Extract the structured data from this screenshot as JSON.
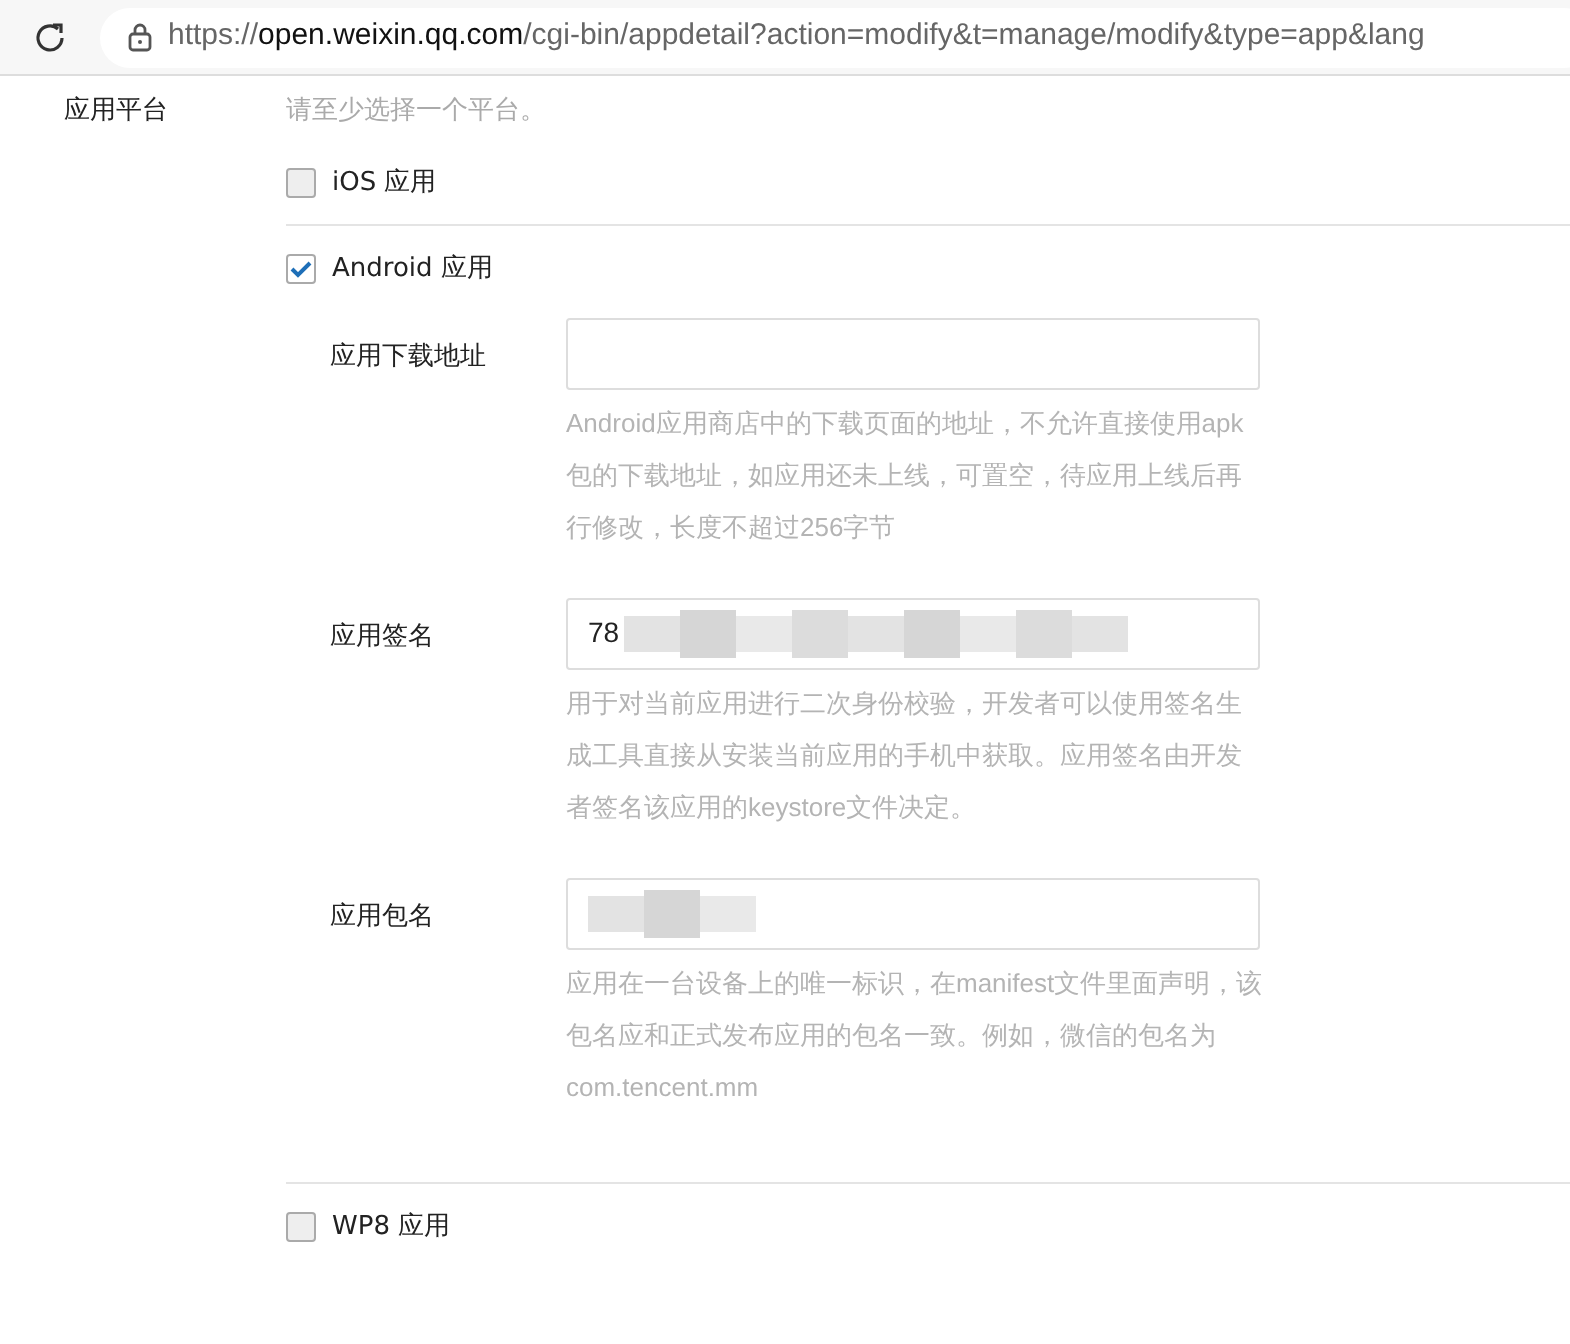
{
  "address_bar": {
    "url_parts": [
      {
        "text": "https://",
        "emphasis": false
      },
      {
        "text": "open.weixin.qq.com",
        "emphasis": true
      },
      {
        "text": "/cgi-bin/appdetail?action=modify&t=manage/modify&type=app&lang",
        "emphasis": false
      }
    ]
  },
  "form": {
    "label": "应用平台",
    "hint": "请至少选择一个平台。",
    "platforms": [
      {
        "label": "iOS 应用",
        "checked": false
      },
      {
        "label": "Android 应用",
        "checked": true,
        "fields": [
          {
            "label": "应用下载地址",
            "help": "Android应用商店中的下载页面的地址，不允许直接使用apk包的下载地址，如应用还未上线，可置空，待应用上线后再行修改，长度不超过256字节",
            "redacted": false
          },
          {
            "label": "应用签名",
            "value": "78",
            "help": "用于对当前应用进行二次身份校验，开发者可以使用签名生成工具直接从安装当前应用的手机中获取。应用签名由开发者签名该应用的keystore文件决定。",
            "redacted": true
          },
          {
            "label": "应用包名",
            "help": "应用在一台设备上的唯一标识，在manifest文件里面声明，该包名应和正式发布应用的包名一致。例如，微信的包名为com.tencent.mm",
            "redacted": true
          }
        ]
      },
      {
        "label": "WP8 应用",
        "checked": false
      }
    ]
  }
}
